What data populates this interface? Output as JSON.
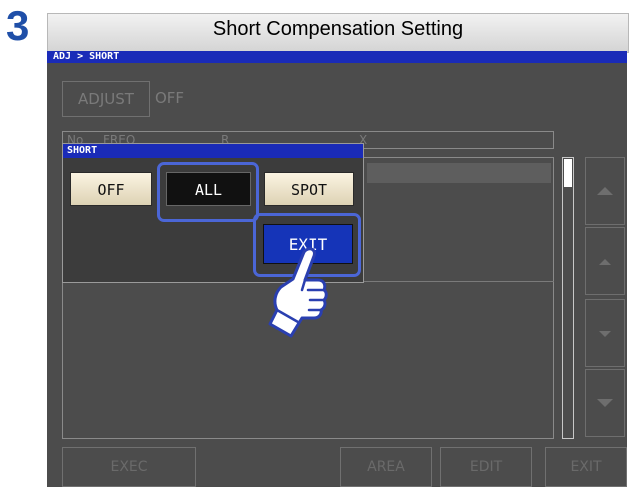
{
  "step_number": "3",
  "title": "Short Compensation Setting",
  "breadcrumb": "ADJ > SHORT",
  "adjust": {
    "label": "ADJUST",
    "value": "OFF"
  },
  "table_headers": [
    "No",
    "FREQ",
    "R",
    "X"
  ],
  "popup": {
    "title": "SHORT",
    "options": [
      "OFF",
      "ALL",
      "SPOT"
    ],
    "selected": "ALL",
    "exit_label": "EXIT"
  },
  "bottom_buttons": [
    "EXEC",
    "AREA",
    "EDIT",
    "EXIT"
  ],
  "colors": {
    "accent_blue": "#1a2bb8",
    "highlight_ring": "#4b66d6",
    "step_number": "#1f4fa8"
  },
  "icons": [
    "pointing-hand-icon",
    "scroll-up-icon",
    "page-up-icon",
    "page-down-icon",
    "scroll-down-icon"
  ]
}
